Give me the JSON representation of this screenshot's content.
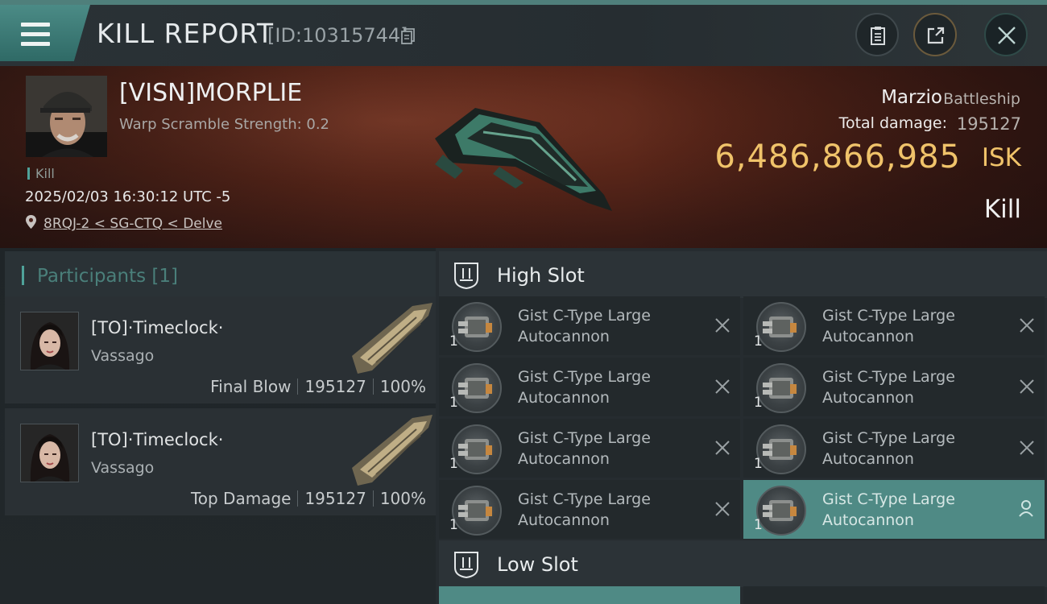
{
  "header": {
    "title": "KILL REPORT",
    "report_id": "[ID:10315744]",
    "icons": [
      "menu-icon",
      "copy-icon",
      "clipboard-icon",
      "share-icon",
      "close-icon"
    ]
  },
  "victim": {
    "name": "[VISN]MORPLIE",
    "warp_scramble": "Warp Scramble Strength: 0.2",
    "tag": "Kill",
    "datetime": "2025/02/03 16:30:12 UTC -5",
    "location": "8RQJ-2 < SG-CTQ < Delve",
    "ship_name": "Marzio",
    "ship_class": "Battleship",
    "total_damage_label": "Total damage:",
    "total_damage": "195127",
    "isk_value": "6,486,866,985",
    "isk_unit": "ISK",
    "result": "Kill"
  },
  "participants": {
    "title": "Participants [1]",
    "rows": [
      {
        "name": "[TO]·Timeclock·",
        "corp": "Vassago",
        "role": "Final Blow",
        "damage": "195127",
        "percent": "100%"
      },
      {
        "name": "[TO]·Timeclock·",
        "corp": "Vassago",
        "role": "Top Damage",
        "damage": "195127",
        "percent": "100%"
      }
    ]
  },
  "slots": {
    "high_slot": {
      "title": "High Slot",
      "modules": [
        {
          "name_line1": "Gist C-Type Large",
          "name_line2": "Autocannon",
          "qty": "1",
          "action_icon": "close-icon"
        },
        {
          "name_line1": "Gist C-Type Large",
          "name_line2": "Autocannon",
          "qty": "1",
          "action_icon": "close-icon"
        },
        {
          "name_line1": "Gist C-Type Large",
          "name_line2": "Autocannon",
          "qty": "1",
          "action_icon": "close-icon"
        },
        {
          "name_line1": "Gist C-Type Large",
          "name_line2": "Autocannon",
          "qty": "1",
          "action_icon": "close-icon"
        },
        {
          "name_line1": "Gist C-Type Large",
          "name_line2": "Autocannon",
          "qty": "1",
          "action_icon": "close-icon"
        },
        {
          "name_line1": "Gist C-Type Large",
          "name_line2": "Autocannon",
          "qty": "1",
          "action_icon": "close-icon"
        },
        {
          "name_line1": "Gist C-Type Large",
          "name_line2": "Autocannon",
          "qty": "1",
          "action_icon": "close-icon"
        },
        {
          "name_line1": "Gist C-Type Large",
          "name_line2": "Autocannon",
          "qty": "1",
          "action_icon": "person-icon"
        }
      ]
    },
    "low_slot": {
      "title": "Low Slot"
    }
  },
  "colors": {
    "accent": "#4f8a85",
    "isk": "#f0c36a",
    "panel": "#2a3034"
  }
}
